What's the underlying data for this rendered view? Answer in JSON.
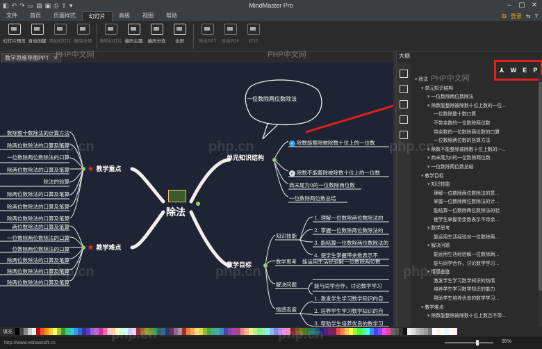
{
  "window": {
    "title": "MindMaster Pro"
  },
  "menu": {
    "items": [
      "文件",
      "首页",
      "页面样式",
      "幻灯片",
      "高级",
      "视图",
      "帮助"
    ],
    "active_index": 3,
    "login": "登录"
  },
  "ribbon": {
    "buttons": [
      {
        "label": "幻灯片预览",
        "dim": false
      },
      {
        "label": "自动创建",
        "dim": false
      },
      {
        "label": "添加幻灯片",
        "dim": true
      },
      {
        "label": "移除全部",
        "dim": true
      },
      {
        "label": "放映幻灯片",
        "dim": true
      },
      {
        "label": "遍历主题",
        "dim": false
      },
      {
        "label": "遍历分支",
        "dim": false
      },
      {
        "label": "全屏",
        "dim": false
      },
      {
        "label": "导出PPT",
        "dim": true
      },
      {
        "label": "导出PDF",
        "dim": true
      },
      {
        "label": "打印",
        "dim": true
      }
    ]
  },
  "document_tab": {
    "label": "数学思维导图PPT"
  },
  "mindmap": {
    "center": "除法",
    "bubble": "一位数除两位数除法",
    "right_branches": [
      {
        "label": "单元知识结构",
        "leaves": [
          "除数能整除被除数十位上的一位数",
          "除数不能整除被除数十位上的一位数",
          "商末尾为0的一位数除两位数",
          "一位数除两位数总结"
        ]
      },
      {
        "label": "教学目标",
        "leaves": [
          "知识技能",
          "数学思考",
          "解决问题",
          "情感态度"
        ]
      }
    ],
    "knowledge_items": [
      "1. 理解一位数除两位数除法的",
      "2. 掌握一位数除两位数除法的",
      "3. 能结算一位数除两位数除法的",
      "4. 使学生掌握带余数表示不"
    ],
    "thinking_items": [
      "能运用生活经验解一位数除两位数",
      "能与同学合作，讨论数学学习"
    ],
    "emotion_items": [
      "1. 激发学生学习数学知识的自",
      "2. 培养学生学习数学知识的自",
      "3. 帮助学生培养优良的数学习"
    ],
    "left_branches": [
      {
        "label": "教学重点",
        "leaves": [
          "数除整十数除法的计算方法",
          "除两位数除法的口算及笔算",
          "一位数除两位数除法的口算",
          "除两位数除法的口算及笔算",
          "除法的验算",
          "除两位数除法的口算及笔算",
          "除两位数除法的口算及笔算",
          "除两位数除法的口算及笔算"
        ]
      },
      {
        "label": "教学难点",
        "leaves": [
          "两位数除法的口算及笔算",
          "一位数除两位数除法的口算",
          "位数除两位数除法的口算",
          "除两位数除法的口算及笔算",
          "除两位数除法的口算及笔算",
          "除两位数除法的口算及笔算"
        ]
      }
    ]
  },
  "outline": {
    "title": "大纲",
    "export_buttons": [
      "W",
      "E",
      "P"
    ],
    "rows": [
      {
        "indent": 0,
        "text": "除法"
      },
      {
        "indent": 1,
        "text": "单元知识结构"
      },
      {
        "indent": 2,
        "text": "一位数除两位数除法"
      },
      {
        "indent": 2,
        "text": "除数能整除被除数十位上数的一位..."
      },
      {
        "indent": 3,
        "text": "一位数除整十数口算"
      },
      {
        "indent": 3,
        "text": "不带余数的一位数除两位数"
      },
      {
        "indent": 3,
        "text": "带余数的一位数除两位数的口算"
      },
      {
        "indent": 3,
        "text": "一位数除两位数的竖算方法"
      },
      {
        "indent": 2,
        "text": "除数不能整除被除数十位上数的一..."
      },
      {
        "indent": 2,
        "text": "商末尾为0的一位数除两位数"
      },
      {
        "indent": 2,
        "text": "一位数除两位数总结"
      },
      {
        "indent": 1,
        "text": "教学目标"
      },
      {
        "indent": 2,
        "text": "知识技能"
      },
      {
        "indent": 3,
        "text": "理解一位数除两位数除法的意..."
      },
      {
        "indent": 3,
        "text": "掌握一位数除两位数除法的计..."
      },
      {
        "indent": 3,
        "text": "能结算一位数除两位数除法的验"
      },
      {
        "indent": 3,
        "text": "使学生掌握带余数表示不带余..."
      },
      {
        "indent": 2,
        "text": "数学思考"
      },
      {
        "indent": 3,
        "text": "能运用生活经验对一位数除两..."
      },
      {
        "indent": 2,
        "text": "解决问题"
      },
      {
        "indent": 3,
        "text": "能运用生活经验解一位数除两..."
      },
      {
        "indent": 3,
        "text": "能与同学合作，讨论数学学习..."
      },
      {
        "indent": 2,
        "text": "情感态度"
      },
      {
        "indent": 3,
        "text": "激发学生学习数学知识的热情"
      },
      {
        "indent": 3,
        "text": "培养学生学习数学知识的能力"
      },
      {
        "indent": 3,
        "text": "帮助学生培养优良的数学学习..."
      },
      {
        "indent": 1,
        "text": "教学难点"
      },
      {
        "indent": 2,
        "text": "除数能整除被除数十位上数且不带..."
      }
    ]
  },
  "palette": {
    "label": "填充"
  },
  "status": {
    "url": "http://www.edrawsoft.cn",
    "zoom": "95%"
  },
  "watermarks": [
    "PHP中文网",
    "php.cn"
  ]
}
